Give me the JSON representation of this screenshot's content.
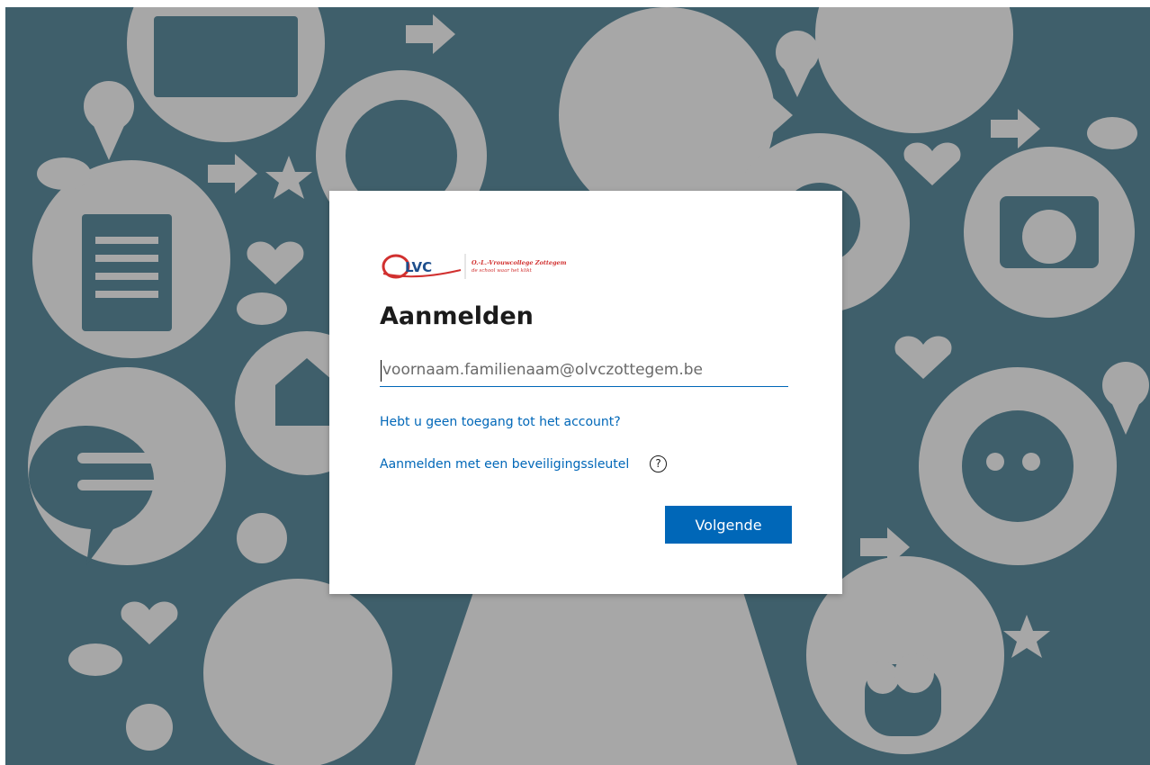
{
  "background": {
    "color": "#3f5f6b",
    "icon_color": "#a7a7a7"
  },
  "logo": {
    "brand": "LVC",
    "school_name": "O.-L.-Vrouwcollege Zottegem",
    "tagline": "de school waar het klikt"
  },
  "signin": {
    "title": "Aanmelden",
    "email_placeholder": "voornaam.familienaam@olvczottegem.be",
    "email_value": "",
    "no_access_link": "Hebt u geen toegang tot het account?",
    "security_key_link": "Aanmelden met een beveiligingssleutel",
    "help_symbol": "?",
    "next_button": "Volgende"
  },
  "colors": {
    "accent": "#0067b8",
    "logo_red": "#d1302f",
    "logo_blue": "#1d4e8c"
  }
}
